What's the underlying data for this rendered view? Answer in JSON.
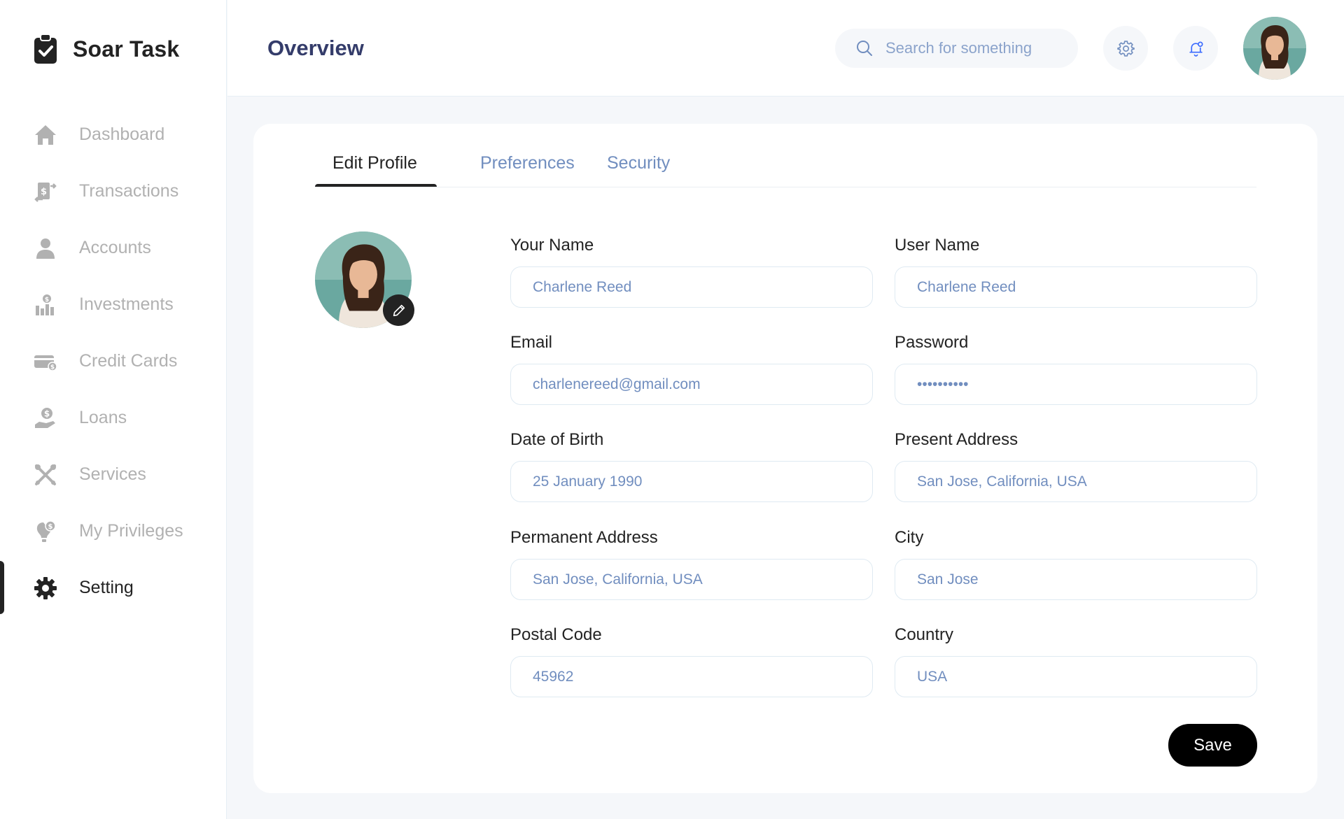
{
  "app": {
    "brand": "Soar Task"
  },
  "sidebar": {
    "items": [
      {
        "label": "Dashboard",
        "icon": "home-icon",
        "active": false
      },
      {
        "label": "Transactions",
        "icon": "transfer-icon",
        "active": false
      },
      {
        "label": "Accounts",
        "icon": "user-icon",
        "active": false
      },
      {
        "label": "Investments",
        "icon": "investment-icon",
        "active": false
      },
      {
        "label": "Credit Cards",
        "icon": "credit-card-icon",
        "active": false
      },
      {
        "label": "Loans",
        "icon": "loan-icon",
        "active": false
      },
      {
        "label": "Services",
        "icon": "services-icon",
        "active": false
      },
      {
        "label": "My Privileges",
        "icon": "privileges-icon",
        "active": false
      },
      {
        "label": "Setting",
        "icon": "gear-icon",
        "active": true
      }
    ]
  },
  "header": {
    "title": "Overview",
    "search_placeholder": "Search for something"
  },
  "tabs": [
    {
      "label": "Edit Profile",
      "active": true
    },
    {
      "label": "Preferences",
      "active": false
    },
    {
      "label": "Security",
      "active": false
    }
  ],
  "form": {
    "your_name": {
      "label": "Your Name",
      "value": "Charlene Reed"
    },
    "user_name": {
      "label": "User Name",
      "value": "Charlene Reed"
    },
    "email": {
      "label": "Email",
      "value": "charlenereed@gmail.com"
    },
    "password": {
      "label": "Password",
      "value": "••••••••••"
    },
    "dob": {
      "label": "Date of Birth",
      "value": "25 January 1990"
    },
    "present_address": {
      "label": "Present Address",
      "value": "San Jose, California, USA"
    },
    "permanent_address": {
      "label": "Permanent Address",
      "value": "San Jose, California, USA"
    },
    "city": {
      "label": "City",
      "value": "San Jose"
    },
    "postal_code": {
      "label": "Postal Code",
      "value": "45962"
    },
    "country": {
      "label": "Country",
      "value": "USA"
    },
    "save_label": "Save"
  },
  "colors": {
    "accent": "#232323",
    "title": "#343c6a",
    "muted_link": "#718ebf",
    "input_border": "#dfeaf2",
    "inactive_nav": "#b1b1b1",
    "background": "#f5f7fa"
  }
}
